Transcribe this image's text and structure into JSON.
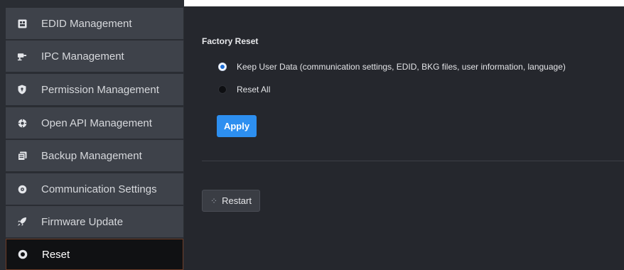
{
  "sidebar": {
    "items": [
      {
        "label": "EDID Management",
        "icon": "edid-icon",
        "active": false
      },
      {
        "label": "IPC Management",
        "icon": "ipc-icon",
        "active": false
      },
      {
        "label": "Permission Management",
        "icon": "shield-icon",
        "active": false
      },
      {
        "label": "Open API Management",
        "icon": "api-icon",
        "active": false
      },
      {
        "label": "Backup Management",
        "icon": "backup-icon",
        "active": false
      },
      {
        "label": "Communication Settings",
        "icon": "communication-icon",
        "active": false
      },
      {
        "label": "Firmware Update",
        "icon": "rocket-icon",
        "active": false
      },
      {
        "label": "Reset",
        "icon": "reset-icon",
        "active": true
      }
    ]
  },
  "factory_reset": {
    "title": "Factory Reset",
    "options": [
      {
        "label": "Keep User Data (communication settings, EDID, BKG files, user information, language)",
        "selected": true
      },
      {
        "label": "Reset All",
        "selected": false
      }
    ],
    "apply_label": "Apply"
  },
  "restart": {
    "label": "Restart",
    "icon": "spinner-icon"
  },
  "colors": {
    "accent": "#2d8ff0",
    "content_bg": "#25272d",
    "sidebar_item_bg": "#3e424a",
    "active_item_bg": "#101113"
  }
}
